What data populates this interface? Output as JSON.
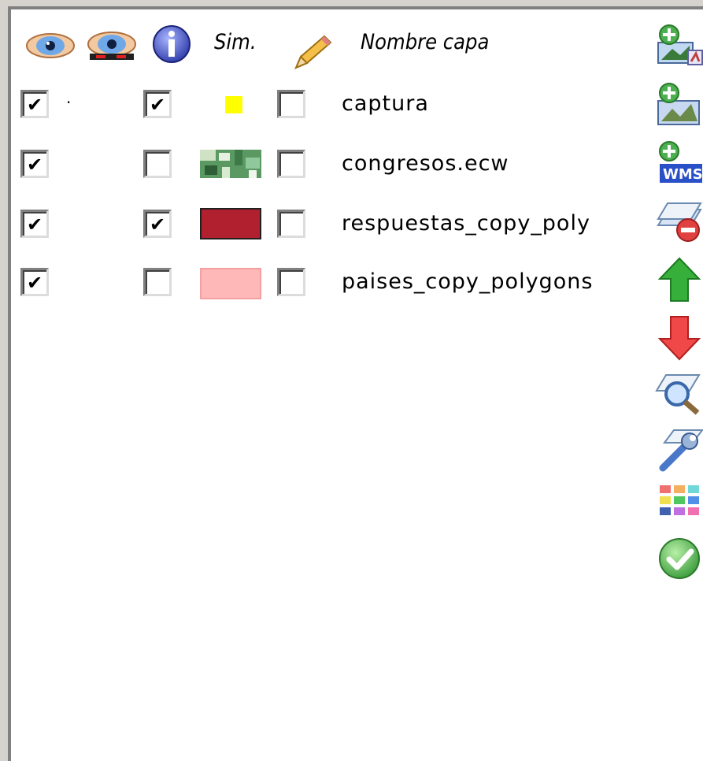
{
  "header": {
    "visible_icon": "eye-icon",
    "active_icon": "eye-disabled-icon",
    "info_icon": "info-icon",
    "symbol_label": "Sim.",
    "edit_icon": "pencil-icon",
    "name_label": "Nombre capa"
  },
  "layers": [
    {
      "name": "captura",
      "visible": true,
      "active": true,
      "editable": false,
      "symbol": "yellow-square",
      "color": "#ffff00"
    },
    {
      "name": "congresos.ecw",
      "visible": true,
      "active": false,
      "editable": false,
      "symbol": "raster-thumbnail",
      "color": "#4a8a52"
    },
    {
      "name": "respuestas_copy_poly",
      "visible": true,
      "active": true,
      "editable": false,
      "symbol": "fill-rect",
      "color": "#b0202e"
    },
    {
      "name": "paises_copy_polygons",
      "visible": true,
      "active": false,
      "editable": false,
      "symbol": "fill-rect",
      "color": "#ffb8b8"
    }
  ],
  "toolbar": [
    "add-layer-icon",
    "add-raster-icon",
    "add-wms-icon",
    "remove-layer-icon",
    "move-up-icon",
    "move-down-icon",
    "zoom-to-layer-icon",
    "layer-properties-icon",
    "color-palette-icon",
    "accept-icon"
  ],
  "colors": {
    "panel_bg": "#ffffff",
    "frame_bg": "#d6d3ce",
    "up_arrow": "#2ea02e",
    "down_arrow": "#e03030"
  }
}
